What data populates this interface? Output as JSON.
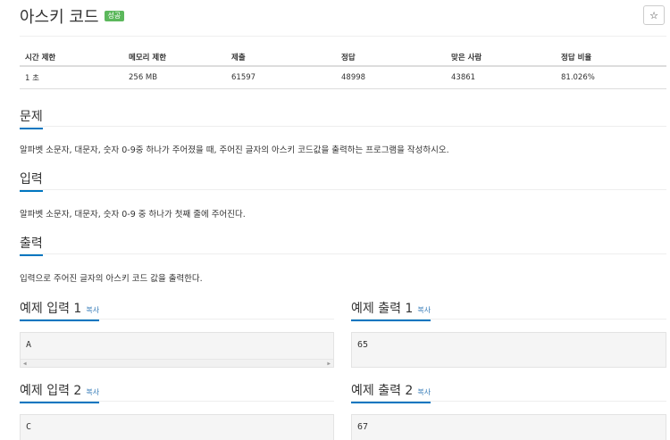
{
  "problem": {
    "title": "아스키 코드",
    "badge": "성공",
    "star": "☆"
  },
  "info_table": {
    "headers": [
      "시간 제한",
      "메모리 제한",
      "제출",
      "정답",
      "맞은 사람",
      "정답 비율"
    ],
    "values": [
      "1 초",
      "256 MB",
      "61597",
      "48998",
      "43861",
      "81.026%"
    ]
  },
  "sections": {
    "problem": {
      "heading": "문제",
      "text": "알파벳 소문자, 대문자, 숫자 0-9중 하나가 주어졌을 때, 주어진 글자의 아스키 코드값을 출력하는 프로그램을 작성하시오."
    },
    "input": {
      "heading": "입력",
      "text": "알파벳 소문자, 대문자, 숫자 0-9 중 하나가 첫째 줄에 주어진다."
    },
    "output": {
      "heading": "출력",
      "text": "입력으로 주어진 글자의 아스키 코드 값을 출력한다."
    }
  },
  "samples": {
    "copy_label": "복사",
    "input1": {
      "heading": "예제 입력 1",
      "value": "A"
    },
    "output1": {
      "heading": "예제 출력 1",
      "value": "65"
    },
    "input2": {
      "heading": "예제 입력 2",
      "value": "C"
    },
    "output2": {
      "heading": "예제 출력 2",
      "value": "67"
    }
  }
}
